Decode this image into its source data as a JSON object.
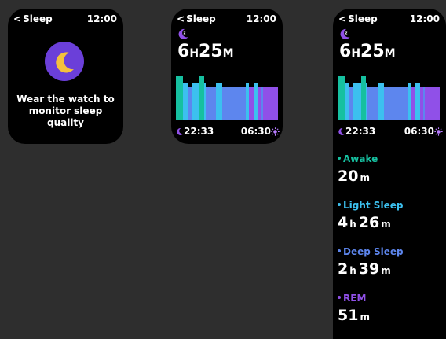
{
  "watch1": {
    "back_label": "Sleep",
    "time": "12:00",
    "message": "Wear the watch to monitor sleep quality",
    "icon": "moon-sleep-icon"
  },
  "watch2": {
    "back_label": "Sleep",
    "time": "12:00",
    "duration": {
      "hours": "6",
      "h_unit": "H",
      "minutes": "25",
      "m_unit": "M"
    },
    "start_time": "22:33",
    "end_time": "06:30"
  },
  "watch3": {
    "back_label": "Sleep",
    "time": "12:00",
    "duration": {
      "hours": "6",
      "h_unit": "H",
      "minutes": "25",
      "m_unit": "M"
    },
    "start_time": "22:33",
    "end_time": "06:30",
    "stages": [
      {
        "label": "Awake",
        "color": "#16c0a0",
        "value": [
          [
            "20",
            "m"
          ]
        ]
      },
      {
        "label": "Light Sleep",
        "color": "#3cc0ef",
        "value": [
          [
            "4",
            "h"
          ],
          [
            "26",
            "m"
          ]
        ]
      },
      {
        "label": "Deep Sleep",
        "color": "#5d86ee",
        "value": [
          [
            "2",
            "h"
          ],
          [
            "39",
            "m"
          ]
        ]
      },
      {
        "label": "REM",
        "color": "#9050e8",
        "value": [
          [
            "51",
            "m"
          ]
        ]
      }
    ]
  },
  "colors": {
    "awake": "#16c0a0",
    "light": "#3cc0ef",
    "deep": "#5d86ee",
    "rem": "#9050e8",
    "moon_bg": "#6b3fd9",
    "moon": "#f5c13d",
    "sun": "#b77cff"
  },
  "chart_data": {
    "type": "bar",
    "x_range": [
      "22:33",
      "06:30"
    ],
    "segments": [
      {
        "stage": "awake",
        "start": 0.0,
        "end": 0.066
      },
      {
        "stage": "light",
        "start": 0.066,
        "end": 0.113
      },
      {
        "stage": "deep",
        "start": 0.113,
        "end": 0.155
      },
      {
        "stage": "light",
        "start": 0.155,
        "end": 0.228
      },
      {
        "stage": "awake",
        "start": 0.228,
        "end": 0.275
      },
      {
        "stage": "light",
        "start": 0.275,
        "end": 0.295
      },
      {
        "stage": "deep",
        "start": 0.295,
        "end": 0.39
      },
      {
        "stage": "light",
        "start": 0.39,
        "end": 0.452
      },
      {
        "stage": "deep",
        "start": 0.452,
        "end": 0.682
      },
      {
        "stage": "light",
        "start": 0.682,
        "end": 0.712
      },
      {
        "stage": "rem",
        "start": 0.712,
        "end": 0.758
      },
      {
        "stage": "light",
        "start": 0.758,
        "end": 0.808
      },
      {
        "stage": "rem",
        "start": 0.808,
        "end": 0.835
      },
      {
        "stage": "deep",
        "start": 0.835,
        "end": 0.85
      },
      {
        "stage": "rem",
        "start": 0.85,
        "end": 1.0
      }
    ],
    "levels": {
      "awake": 1.0,
      "light": 0.85,
      "deep": 0.75,
      "rem": 0.75
    }
  }
}
